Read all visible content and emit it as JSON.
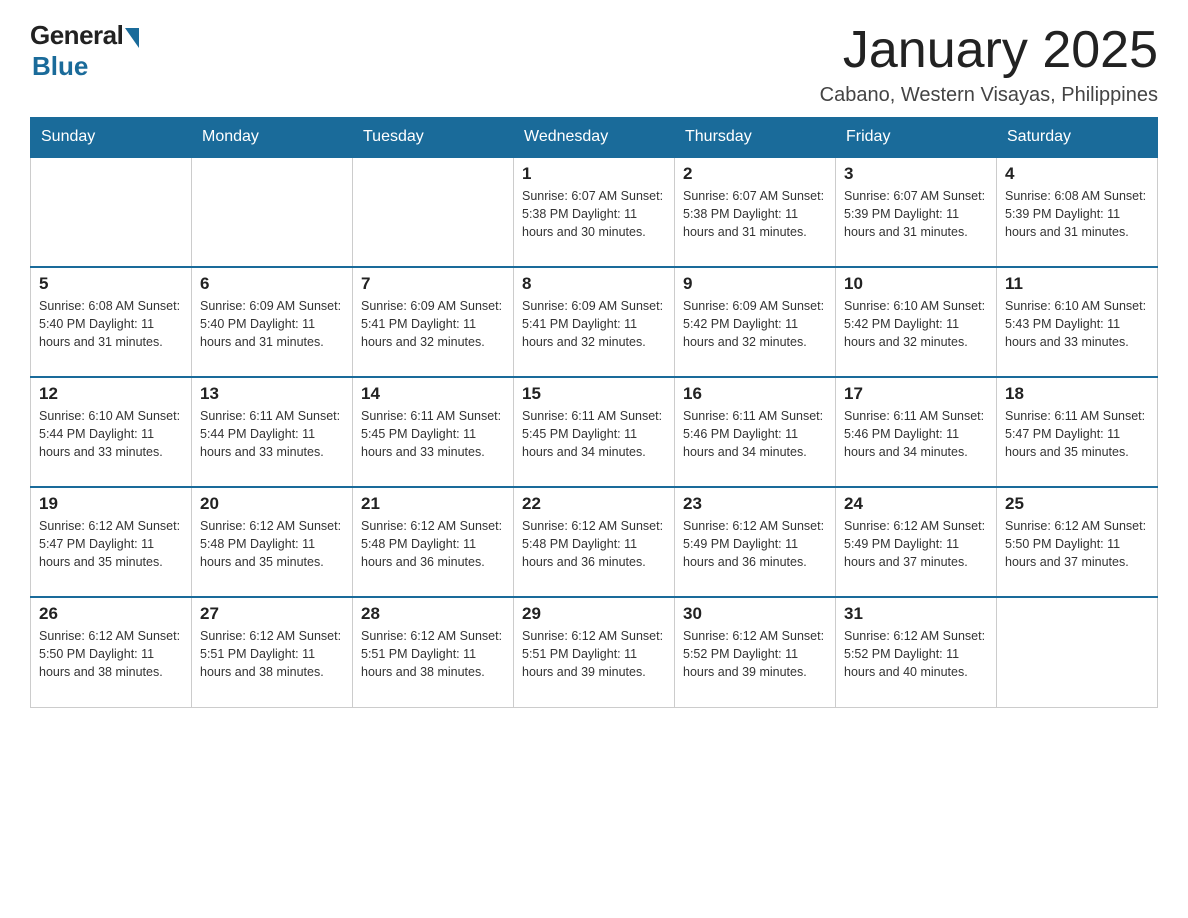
{
  "header": {
    "logo_general": "General",
    "logo_blue": "Blue",
    "month_title": "January 2025",
    "location": "Cabano, Western Visayas, Philippines"
  },
  "days_of_week": [
    "Sunday",
    "Monday",
    "Tuesday",
    "Wednesday",
    "Thursday",
    "Friday",
    "Saturday"
  ],
  "weeks": [
    [
      {
        "day": "",
        "info": ""
      },
      {
        "day": "",
        "info": ""
      },
      {
        "day": "",
        "info": ""
      },
      {
        "day": "1",
        "info": "Sunrise: 6:07 AM\nSunset: 5:38 PM\nDaylight: 11 hours\nand 30 minutes."
      },
      {
        "day": "2",
        "info": "Sunrise: 6:07 AM\nSunset: 5:38 PM\nDaylight: 11 hours\nand 31 minutes."
      },
      {
        "day": "3",
        "info": "Sunrise: 6:07 AM\nSunset: 5:39 PM\nDaylight: 11 hours\nand 31 minutes."
      },
      {
        "day": "4",
        "info": "Sunrise: 6:08 AM\nSunset: 5:39 PM\nDaylight: 11 hours\nand 31 minutes."
      }
    ],
    [
      {
        "day": "5",
        "info": "Sunrise: 6:08 AM\nSunset: 5:40 PM\nDaylight: 11 hours\nand 31 minutes."
      },
      {
        "day": "6",
        "info": "Sunrise: 6:09 AM\nSunset: 5:40 PM\nDaylight: 11 hours\nand 31 minutes."
      },
      {
        "day": "7",
        "info": "Sunrise: 6:09 AM\nSunset: 5:41 PM\nDaylight: 11 hours\nand 32 minutes."
      },
      {
        "day": "8",
        "info": "Sunrise: 6:09 AM\nSunset: 5:41 PM\nDaylight: 11 hours\nand 32 minutes."
      },
      {
        "day": "9",
        "info": "Sunrise: 6:09 AM\nSunset: 5:42 PM\nDaylight: 11 hours\nand 32 minutes."
      },
      {
        "day": "10",
        "info": "Sunrise: 6:10 AM\nSunset: 5:42 PM\nDaylight: 11 hours\nand 32 minutes."
      },
      {
        "day": "11",
        "info": "Sunrise: 6:10 AM\nSunset: 5:43 PM\nDaylight: 11 hours\nand 33 minutes."
      }
    ],
    [
      {
        "day": "12",
        "info": "Sunrise: 6:10 AM\nSunset: 5:44 PM\nDaylight: 11 hours\nand 33 minutes."
      },
      {
        "day": "13",
        "info": "Sunrise: 6:11 AM\nSunset: 5:44 PM\nDaylight: 11 hours\nand 33 minutes."
      },
      {
        "day": "14",
        "info": "Sunrise: 6:11 AM\nSunset: 5:45 PM\nDaylight: 11 hours\nand 33 minutes."
      },
      {
        "day": "15",
        "info": "Sunrise: 6:11 AM\nSunset: 5:45 PM\nDaylight: 11 hours\nand 34 minutes."
      },
      {
        "day": "16",
        "info": "Sunrise: 6:11 AM\nSunset: 5:46 PM\nDaylight: 11 hours\nand 34 minutes."
      },
      {
        "day": "17",
        "info": "Sunrise: 6:11 AM\nSunset: 5:46 PM\nDaylight: 11 hours\nand 34 minutes."
      },
      {
        "day": "18",
        "info": "Sunrise: 6:11 AM\nSunset: 5:47 PM\nDaylight: 11 hours\nand 35 minutes."
      }
    ],
    [
      {
        "day": "19",
        "info": "Sunrise: 6:12 AM\nSunset: 5:47 PM\nDaylight: 11 hours\nand 35 minutes."
      },
      {
        "day": "20",
        "info": "Sunrise: 6:12 AM\nSunset: 5:48 PM\nDaylight: 11 hours\nand 35 minutes."
      },
      {
        "day": "21",
        "info": "Sunrise: 6:12 AM\nSunset: 5:48 PM\nDaylight: 11 hours\nand 36 minutes."
      },
      {
        "day": "22",
        "info": "Sunrise: 6:12 AM\nSunset: 5:48 PM\nDaylight: 11 hours\nand 36 minutes."
      },
      {
        "day": "23",
        "info": "Sunrise: 6:12 AM\nSunset: 5:49 PM\nDaylight: 11 hours\nand 36 minutes."
      },
      {
        "day": "24",
        "info": "Sunrise: 6:12 AM\nSunset: 5:49 PM\nDaylight: 11 hours\nand 37 minutes."
      },
      {
        "day": "25",
        "info": "Sunrise: 6:12 AM\nSunset: 5:50 PM\nDaylight: 11 hours\nand 37 minutes."
      }
    ],
    [
      {
        "day": "26",
        "info": "Sunrise: 6:12 AM\nSunset: 5:50 PM\nDaylight: 11 hours\nand 38 minutes."
      },
      {
        "day": "27",
        "info": "Sunrise: 6:12 AM\nSunset: 5:51 PM\nDaylight: 11 hours\nand 38 minutes."
      },
      {
        "day": "28",
        "info": "Sunrise: 6:12 AM\nSunset: 5:51 PM\nDaylight: 11 hours\nand 38 minutes."
      },
      {
        "day": "29",
        "info": "Sunrise: 6:12 AM\nSunset: 5:51 PM\nDaylight: 11 hours\nand 39 minutes."
      },
      {
        "day": "30",
        "info": "Sunrise: 6:12 AM\nSunset: 5:52 PM\nDaylight: 11 hours\nand 39 minutes."
      },
      {
        "day": "31",
        "info": "Sunrise: 6:12 AM\nSunset: 5:52 PM\nDaylight: 11 hours\nand 40 minutes."
      },
      {
        "day": "",
        "info": ""
      }
    ]
  ]
}
